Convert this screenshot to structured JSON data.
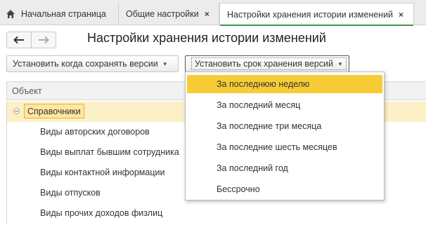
{
  "tabs": {
    "home": "Начальная страница",
    "general": "Общие настройки",
    "active": "Настройки хранения истории изменений",
    "close_glyph": "×"
  },
  "page": {
    "title": "Настройки хранения истории изменений"
  },
  "toolbar": {
    "when_label": "Установить когда сохранять версии",
    "term_label": "Установить срок хранения версий",
    "arrow": "▼"
  },
  "table": {
    "column_object": "Объект",
    "group_label": "Справочники",
    "rows": [
      "Виды авторских договоров",
      "Виды выплат бывшим сотрудника",
      "Виды контактной информации",
      "Виды отпусков",
      "Виды прочих доходов физлиц"
    ]
  },
  "dropdown": {
    "items": [
      "За последнюю неделю",
      "За последний месяц",
      "За последние три месяца",
      "За последние шесть месяцев",
      "За последний год",
      "Бессрочно"
    ],
    "selected_index": 0
  },
  "icons": {
    "home": "home-icon",
    "back": "arrow-left-icon",
    "forward": "arrow-right-icon",
    "collapse": "collapse-icon"
  },
  "colors": {
    "accent_green": "#3c9a3c",
    "selection_yellow": "#f7cc36",
    "group_row_bg": "#fbf0c6"
  }
}
